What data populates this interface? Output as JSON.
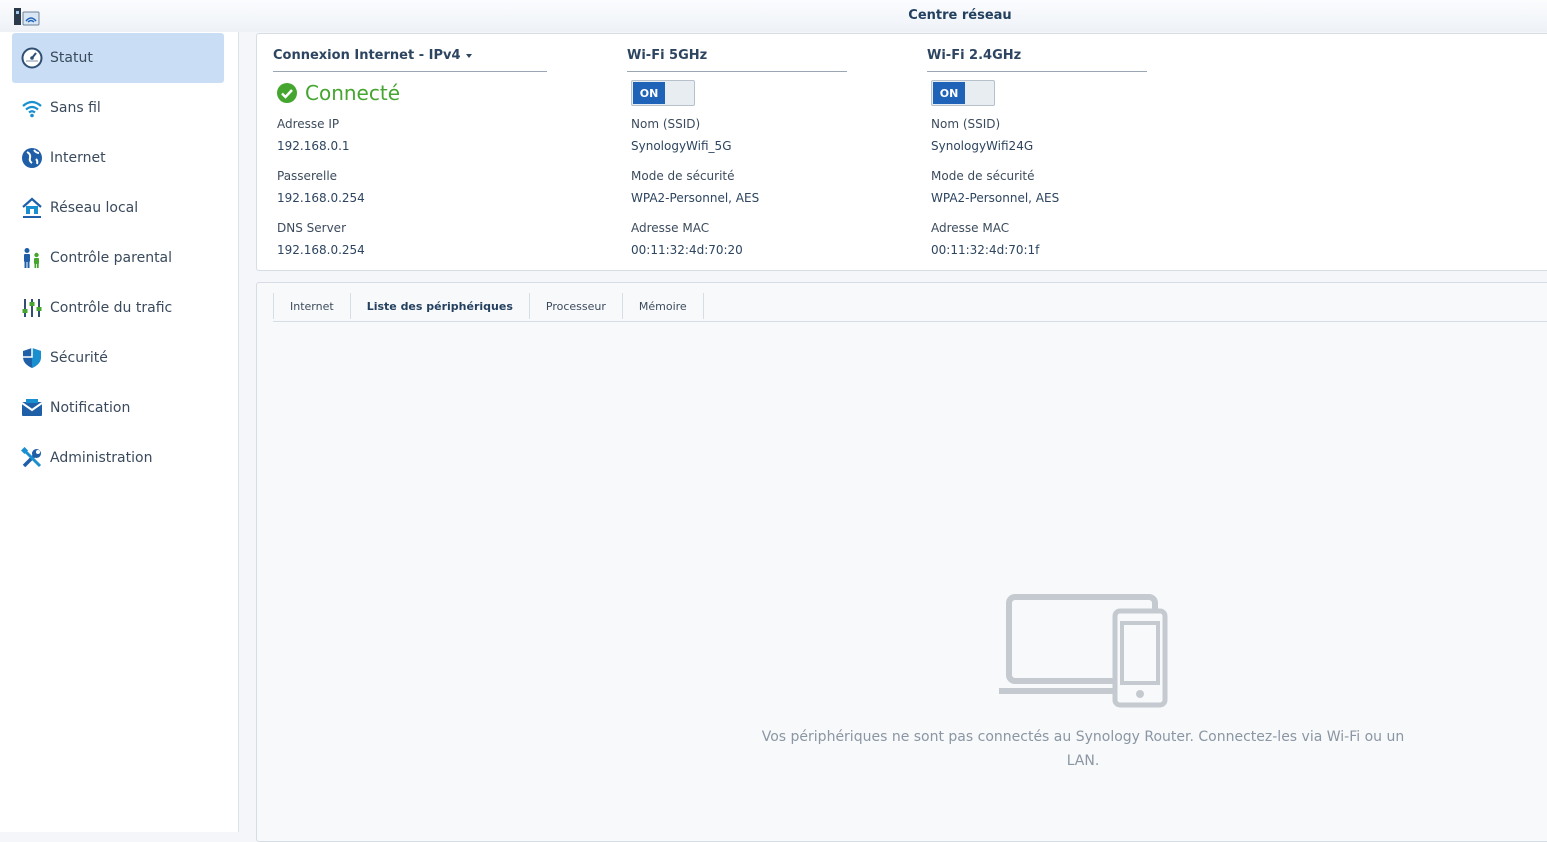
{
  "window": {
    "title": "Centre réseau"
  },
  "sidebar": {
    "items": [
      {
        "label": "Statut",
        "icon": "gauge-icon",
        "active": true
      },
      {
        "label": "Sans fil",
        "icon": "wifi-icon"
      },
      {
        "label": "Internet",
        "icon": "globe-icon"
      },
      {
        "label": "Réseau local",
        "icon": "home-network-icon"
      },
      {
        "label": "Contrôle parental",
        "icon": "family-icon"
      },
      {
        "label": "Contrôle du trafic",
        "icon": "sliders-icon"
      },
      {
        "label": "Sécurité",
        "icon": "shield-icon"
      },
      {
        "label": "Notification",
        "icon": "mail-icon"
      },
      {
        "label": "Administration",
        "icon": "tools-icon"
      }
    ]
  },
  "internet": {
    "heading": "Connexion Internet - IPv4",
    "status": "Connecté",
    "fields": [
      {
        "label": "Adresse IP",
        "value": "192.168.0.1"
      },
      {
        "label": "Passerelle",
        "value": "192.168.0.254"
      },
      {
        "label": "DNS Server",
        "value": "192.168.0.254"
      }
    ]
  },
  "wifi5": {
    "heading": "Wi-Fi 5GHz",
    "toggle": "ON",
    "fields": [
      {
        "label": "Nom (SSID)",
        "value": "SynologyWifi_5G"
      },
      {
        "label": "Mode de sécurité",
        "value": "WPA2-Personnel, AES"
      },
      {
        "label": "Adresse MAC",
        "value": "00:11:32:4d:70:20"
      }
    ]
  },
  "wifi24": {
    "heading": "Wi-Fi 2.4GHz",
    "toggle": "ON",
    "fields": [
      {
        "label": "Nom (SSID)",
        "value": "SynologyWifi24G"
      },
      {
        "label": "Mode de sécurité",
        "value": "WPA2-Personnel, AES"
      },
      {
        "label": "Adresse MAC",
        "value": "00:11:32:4d:70:1f"
      }
    ]
  },
  "tabs": [
    {
      "label": "Internet"
    },
    {
      "label": "Liste des périphériques",
      "active": true
    },
    {
      "label": "Processeur"
    },
    {
      "label": "Mémoire"
    }
  ],
  "empty_state": {
    "message": "Vos périphériques ne sont pas connectés au Synology Router. Connectez-les via Wi-Fi ou un LAN."
  },
  "colors": {
    "accent": "#1e63b8",
    "success": "#45a62f",
    "active_nav": "#c9def4"
  }
}
